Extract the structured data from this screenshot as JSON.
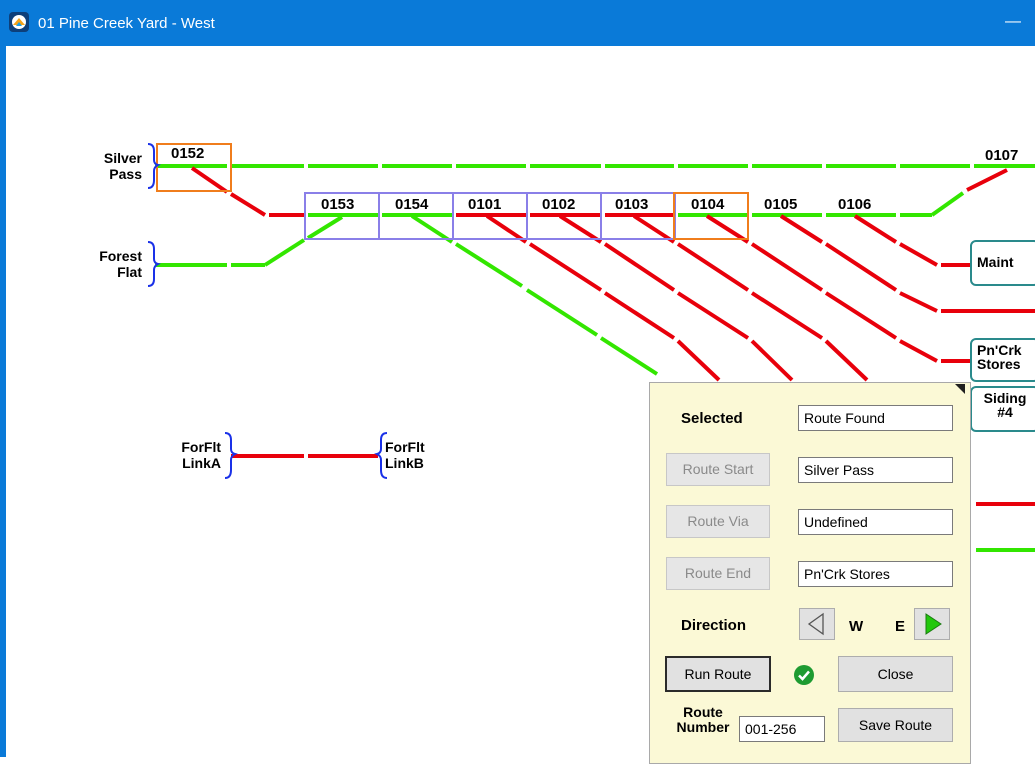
{
  "window": {
    "title": "01 Pine Creek Yard - West",
    "minimize_glyph": "—",
    "icon": "app-logo-icon"
  },
  "endpoints": {
    "silver_pass": "Silver\nPass",
    "forest_flat": "Forest\nFlat",
    "forflt_link_a": "ForFlt\nLinkA",
    "forflt_link_b": "ForFlt\nLinkB"
  },
  "blocks": {
    "b0152": "0152",
    "b0153": "0153",
    "b0154": "0154",
    "b0101": "0101",
    "b0102": "0102",
    "b0103": "0103",
    "b0104": "0104",
    "b0105": "0105",
    "b0106": "0106",
    "b0107": "0107"
  },
  "destinations": {
    "maint": "Maint",
    "pncrk_stores": "Pn'Crk\nStores",
    "siding4": "Siding\n#4"
  },
  "route_panel": {
    "selected_label": "Selected",
    "selected_value": "Route Found",
    "route_start_button": "Route Start",
    "route_start_value": "Silver Pass",
    "route_via_button": "Route Via",
    "route_via_value": "Undefined",
    "route_end_button": "Route End",
    "route_end_value": "Pn'Crk Stores",
    "direction_label": "Direction",
    "dir_w": "W",
    "dir_e": "E",
    "run_route_button": "Run Route",
    "status_icon": "checkmark-icon",
    "close_button": "Close",
    "route_number_label": "Route\nNumber",
    "route_number_value": "001-256",
    "save_route_button": "Save Route"
  },
  "colors": {
    "titlebar": "#0a7ad8",
    "track_clear": "#33e600",
    "track_occupied": "#e8000b",
    "selected_block": "#f07d1c",
    "route_block": "#8a7fe8",
    "bracket": "#1a31e8",
    "destination_border": "#2a8a8c",
    "panel_bg": "#fbf9d6",
    "status_ok": "#1e9b31",
    "arrow_active": "#22c80c"
  }
}
